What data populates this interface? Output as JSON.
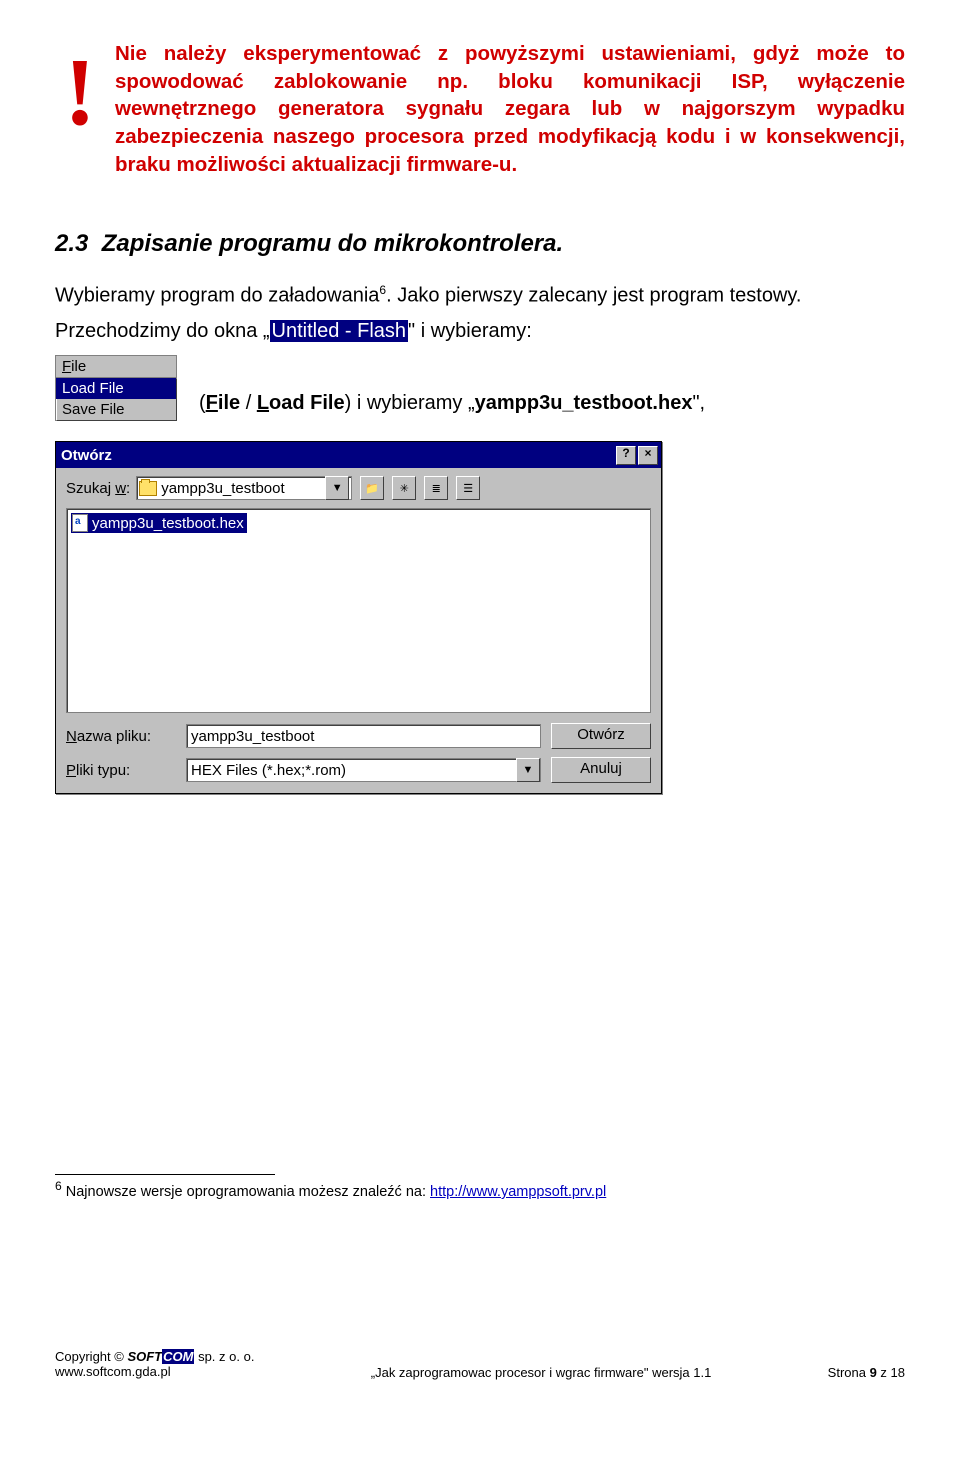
{
  "warning": {
    "mark": "!",
    "text": "Nie należy eksperymentować z powyższymi ustawieniami, gdyż może to spowodować zablokowanie np. bloku komunikacji ISP, wyłączenie wewnętrznego generatora sygnału zegara lub w najgorszym wypadku zabezpieczenia naszego procesora przed modyfikacją kodu i w konsekwencji, braku możliwości aktualizacji firmware-u."
  },
  "section": {
    "number": "2.3",
    "title": "Zapisanie programu do mikrokontrolera."
  },
  "para1_a": "Wybieramy program do załadowania",
  "para1_sup": "6",
  "para1_b": ". Jako pierwszy zalecany jest program testowy.",
  "para2_a": "Przechodzimy do okna „",
  "para2_hl": "Untitled - Flash",
  "para2_b": "\" i wybieramy:",
  "filemenu": {
    "title_pre": "",
    "title_u": "F",
    "title_post": "ile",
    "items": [
      "Load File",
      "Save File"
    ],
    "caption_pre": "(",
    "caption_file_u": "F",
    "caption_file_rest": "ile",
    "caption_mid": " / ",
    "caption_load_u": "L",
    "caption_load_rest": "oad File",
    "caption_post": ") i wybieramy „",
    "caption_fname": "yampp3u_testboot.hex",
    "caption_end": "\","
  },
  "dialog": {
    "title": "Otwórz",
    "help": "?",
    "close": "×",
    "lookin_label_u": "w",
    "lookin_label_pre": "Szukaj ",
    "lookin_label_post": ":",
    "lookin_value": "yampp3u_testboot",
    "list_item": "yampp3u_testboot.hex",
    "name_label_u": "N",
    "name_label_rest": "azwa pliku:",
    "name_value": "yampp3u_testboot",
    "type_label_u": "P",
    "type_label_rest": "liki typu:",
    "type_value": "HEX Files (*.hex;*.rom)",
    "open_btn_u": "O",
    "open_btn_rest": "twórz",
    "cancel_btn": "Anuluj"
  },
  "footnote": {
    "num": "6",
    "text": " Najnowsze wersje oprogramowania możesz znaleźć na: ",
    "url": "http://www.yamppsoft.prv.pl"
  },
  "footer": {
    "copyright_pre": "Copyright © ",
    "soft": "SOFT",
    "com": "COM",
    "copyright_post": " sp. z o. o.",
    "www": "www.softcom.gda.pl",
    "center": "„Jak zaprogramowac procesor i wgrac firmware\" wersja 1.1",
    "page_pre": "Strona ",
    "page_num": "9",
    "page_post": " z 18"
  }
}
